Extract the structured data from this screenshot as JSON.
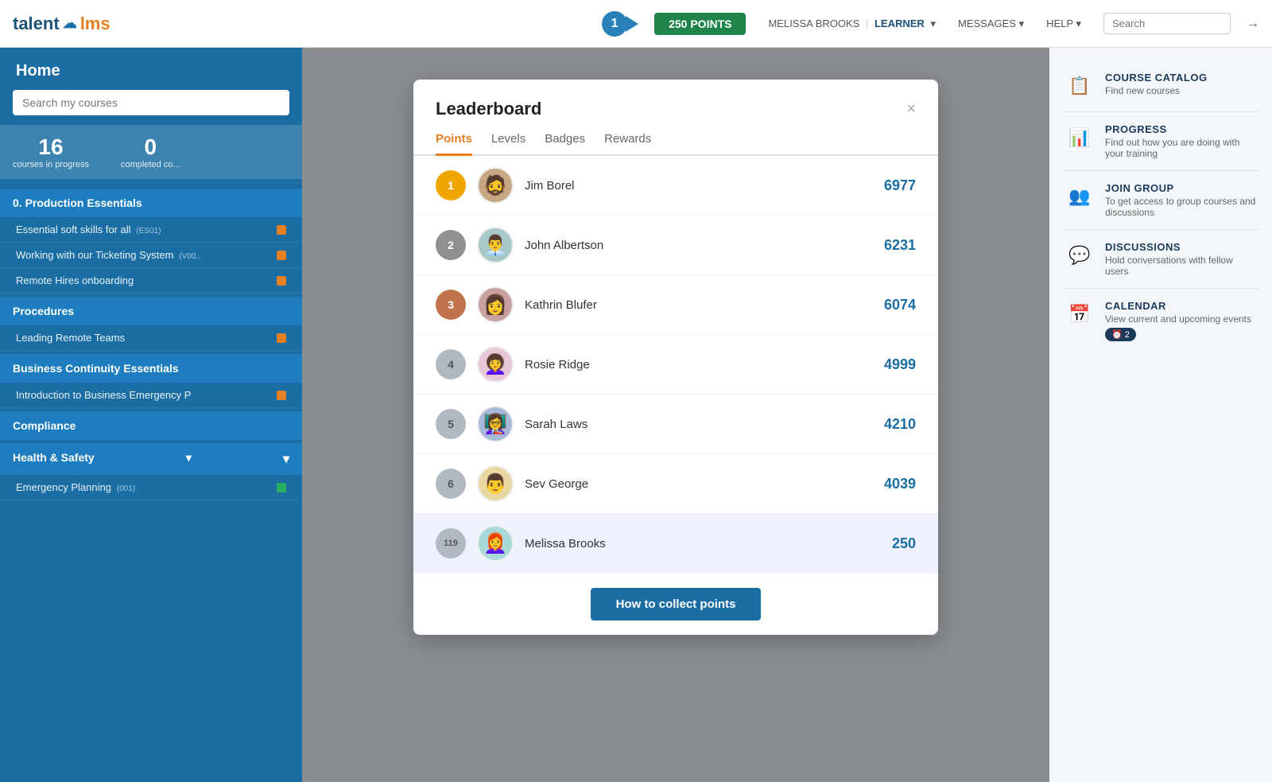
{
  "header": {
    "logo_talent": "talent",
    "logo_lms": "lms",
    "notification_count": "1",
    "points_label": "250 POINTS",
    "user_name": "MELISSA BROOKS",
    "user_role": "LEARNER",
    "messages_label": "MESSAGES",
    "help_label": "HELP",
    "search_placeholder": "Search",
    "exit_icon": "→"
  },
  "sidebar_left": {
    "home_title": "Home",
    "search_placeholder": "Search my courses",
    "stat_in_progress": "16",
    "stat_in_progress_label": "courses in progress",
    "stat_completed": "0",
    "stat_completed_label": "completed co...",
    "sections": [
      {
        "title": "0. Production Essentials",
        "courses": [
          {
            "name": "Essential soft skills for all",
            "tag": "(ES01)"
          },
          {
            "name": "Working with our Ticketing System",
            "tag": "(V00..."
          },
          {
            "name": "Remote Hires onboarding",
            "tag": ""
          }
        ]
      },
      {
        "title": "Procedures",
        "courses": [
          {
            "name": "Leading Remote Teams",
            "tag": ""
          }
        ]
      },
      {
        "title": "Business Continuity Essentials",
        "courses": [
          {
            "name": "Introduction to Business Emergency P",
            "tag": ""
          }
        ]
      },
      {
        "title": "Compliance",
        "courses": []
      },
      {
        "title": "Health & Safety",
        "courses": [
          {
            "name": "Emergency Planning",
            "tag": "(001)"
          }
        ]
      }
    ]
  },
  "modal": {
    "title": "Leaderboard",
    "close_label": "×",
    "tabs": [
      {
        "label": "Points",
        "active": true
      },
      {
        "label": "Levels",
        "active": false
      },
      {
        "label": "Badges",
        "active": false
      },
      {
        "label": "Rewards",
        "active": false
      }
    ],
    "entries": [
      {
        "rank": "1",
        "rank_type": "gold",
        "name": "Jim Borel",
        "score": "6977",
        "avatar_emoji": "🧔"
      },
      {
        "rank": "2",
        "rank_type": "silver",
        "name": "John Albertson",
        "score": "6231",
        "avatar_emoji": "👨‍💼"
      },
      {
        "rank": "3",
        "rank_type": "bronze",
        "name": "Kathrin Blufer",
        "score": "6074",
        "avatar_emoji": "👩"
      },
      {
        "rank": "4",
        "rank_type": "plain",
        "name": "Rosie Ridge",
        "score": "4999",
        "avatar_emoji": "👩‍🦱"
      },
      {
        "rank": "5",
        "rank_type": "plain",
        "name": "Sarah Laws",
        "score": "4210",
        "avatar_emoji": "👩‍🏫"
      },
      {
        "rank": "6",
        "rank_type": "plain",
        "name": "Sev George",
        "score": "4039",
        "avatar_emoji": "👨"
      },
      {
        "rank": "119",
        "rank_type": "plain-lg",
        "name": "Melissa Brooks",
        "score": "250",
        "avatar_emoji": "👩‍🦰",
        "highlighted": true
      }
    ],
    "cta_label": "How to collect points"
  },
  "right_sidebar": {
    "items": [
      {
        "title": "COURSE CATALOG",
        "desc": "Find new courses",
        "icon": "📋"
      },
      {
        "title": "PROGRESS",
        "desc": "Find out how you are doing with your training",
        "icon": "📊"
      },
      {
        "title": "JOIN GROUP",
        "desc": "To get access to group courses and discussions",
        "icon": "👥"
      },
      {
        "title": "DISCUSSIONS",
        "desc": "Hold conversations with fellow users",
        "icon": "💬"
      },
      {
        "title": "CALENDAR",
        "desc": "View current and upcoming events",
        "icon": "📅",
        "badge": "2"
      }
    ]
  }
}
